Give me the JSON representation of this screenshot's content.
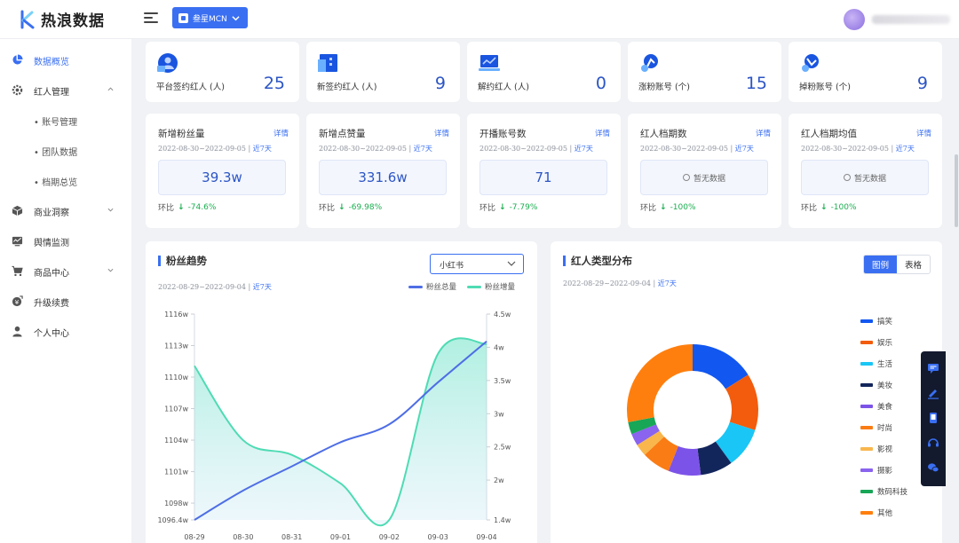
{
  "app": {
    "logo_text": "热浪数据"
  },
  "header": {
    "mcn_button": "叁星MCN"
  },
  "sidebar": {
    "items": [
      {
        "label": "数据概览",
        "icon": "pie-chart-icon"
      },
      {
        "label": "红人管理",
        "icon": "gear-icon"
      },
      {
        "label": "商业洞察",
        "icon": "cube-icon"
      },
      {
        "label": "舆情监测",
        "icon": "monitor-icon"
      },
      {
        "label": "商品中心",
        "icon": "cart-icon"
      },
      {
        "label": "升级续费",
        "icon": "coin-icon"
      },
      {
        "label": "个人中心",
        "icon": "user-icon"
      }
    ],
    "subitems": [
      "• 账号管理",
      "• 团队数据",
      "• 档期总览"
    ]
  },
  "stats": [
    {
      "label": "平台签约红人 (人)",
      "value": "25",
      "icon": "user-card-icon"
    },
    {
      "label": "新签约红人 (人)",
      "value": "9",
      "icon": "building-icon"
    },
    {
      "label": "解约红人 (人)",
      "value": "0",
      "icon": "laptop-chart-icon"
    },
    {
      "label": "涨粉账号 (个)",
      "value": "15",
      "icon": "rocket-up-icon"
    },
    {
      "label": "掉粉账号 (个)",
      "value": "9",
      "icon": "rocket-down-icon"
    }
  ],
  "metrics": [
    {
      "title": "新增粉丝量",
      "detail": "详情",
      "date": "2022-08-30~2022-09-05 | ",
      "date_link": "近7天",
      "value": "39.3w",
      "trend_label": "环比",
      "trend": "-74.6%"
    },
    {
      "title": "新增点赞量",
      "detail": "详情",
      "date": "2022-08-30~2022-09-05 | ",
      "date_link": "近7天",
      "value": "331.6w",
      "trend_label": "环比",
      "trend": "-69.98%"
    },
    {
      "title": "开播账号数",
      "detail": "详情",
      "date": "2022-08-30~2022-09-05 | ",
      "date_link": "近7天",
      "value": "71",
      "trend_label": "环比",
      "trend": "-7.79%"
    },
    {
      "title": "红人档期数",
      "detail": "详情",
      "date": "2022-08-30~2022-09-05 | ",
      "date_link": "近7天",
      "value": "暂无数据",
      "trend_label": "环比",
      "trend": "-100%"
    },
    {
      "title": "红人档期均值",
      "detail": "详情",
      "date": "2022-08-30~2022-09-05 | ",
      "date_link": "近7天",
      "value": "暂无数据",
      "trend_label": "环比",
      "trend": "-100%"
    }
  ],
  "fan_trend": {
    "title": "粉丝趋势",
    "date": "2022-08-29~2022-09-04 | ",
    "date_link": "近7天",
    "platform_select": "小红书"
  },
  "type_dist": {
    "title": "红人类型分布",
    "date": "2022-08-29~2022-09-04 | ",
    "date_link": "近7天",
    "toggle": [
      "图例",
      "表格"
    ]
  },
  "chart_data": [
    {
      "type": "line",
      "x": [
        "08-29",
        "08-30",
        "08-31",
        "09-01",
        "09-02",
        "09-03",
        "09-04"
      ],
      "series": [
        {
          "name": "粉丝总量",
          "axis": "left",
          "color": "#4e6ee6",
          "values": [
            1096.4,
            1099.2,
            1101.5,
            1103.8,
            1105.5,
            1109.5,
            1113.4
          ]
        },
        {
          "name": "粉丝增量",
          "axis": "right",
          "color": "#4fdbb4",
          "values": [
            3.72,
            2.6,
            2.38,
            1.95,
            1.4,
            3.9,
            4.05
          ]
        }
      ],
      "y_left_ticks": [
        "1116w",
        "1113w",
        "1110w",
        "1107w",
        "1104w",
        "1101w",
        "1098w",
        "1096.4w"
      ],
      "y_left_values": [
        1116,
        1113,
        1110,
        1107,
        1104,
        1101,
        1098,
        1096.4
      ],
      "y_right_ticks": [
        "4.5w",
        "4w",
        "3.5w",
        "3w",
        "2.5w",
        "2w",
        "1.4w"
      ],
      "y_right_values": [
        4.5,
        4,
        3.5,
        3,
        2.5,
        2,
        1.4
      ],
      "grid": false,
      "legend": "top-right"
    },
    {
      "type": "pie",
      "donut": true,
      "categories": [
        "搞笑",
        "娱乐",
        "生活",
        "美妆",
        "美食",
        "时尚",
        "影视",
        "摄影",
        "数码科技",
        "其他"
      ],
      "values": [
        16,
        14,
        10,
        8,
        8,
        7,
        3,
        3,
        3,
        28
      ],
      "colors": [
        "#1257f0",
        "#f25c0c",
        "#19c6f5",
        "#13265c",
        "#7c53e8",
        "#fa7c15",
        "#f8b64c",
        "#8a63ee",
        "#18a657",
        "#ff7f0e"
      ],
      "legend": "right"
    }
  ]
}
